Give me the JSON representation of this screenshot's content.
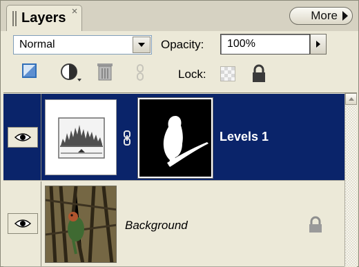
{
  "panel": {
    "tab_label": "Layers",
    "more_label": "More"
  },
  "blend": {
    "mode": "Normal",
    "opacity_label": "Opacity:",
    "opacity_value": "100%"
  },
  "lock": {
    "label": "Lock:"
  },
  "layers": [
    {
      "name": "Levels 1",
      "visible": true,
      "selected": true,
      "type": "adjustment-levels",
      "has_mask": true
    },
    {
      "name": "Background",
      "visible": true,
      "selected": false,
      "type": "image",
      "locked": true
    }
  ],
  "colors": {
    "selection": "#0a246a",
    "panel_bg": "#ece9d8"
  }
}
